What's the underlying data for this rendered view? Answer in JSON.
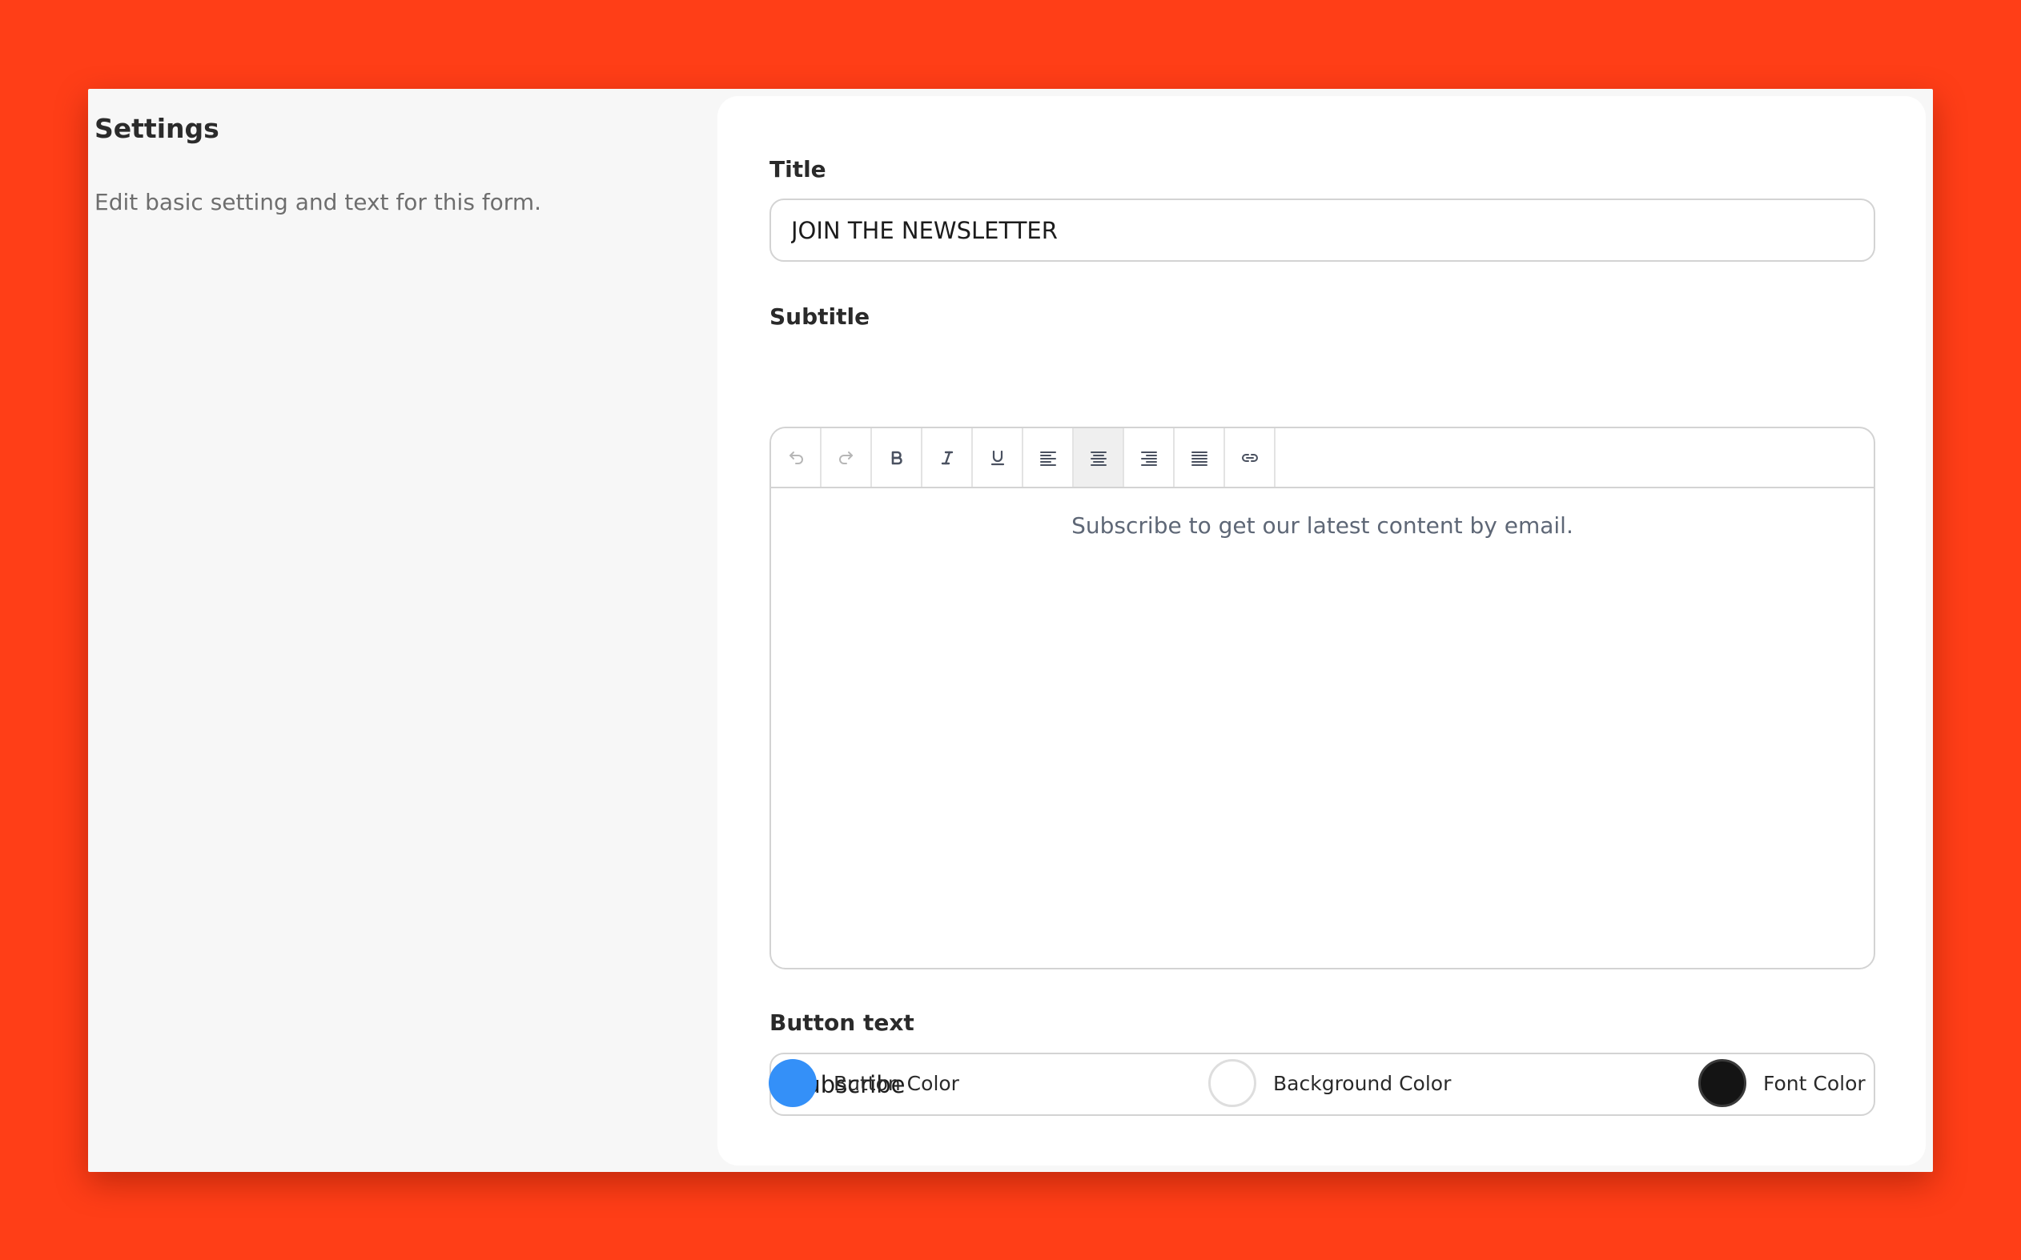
{
  "settings": {
    "heading": "Settings",
    "description": "Edit basic setting and text for this form."
  },
  "form": {
    "title_label": "Title",
    "title_value": "JOIN THE NEWSLETTER",
    "subtitle_label": "Subtitle",
    "subtitle_text": "Subscribe to get our latest content by email.",
    "button_text_label": "Button text",
    "button_text_value": "Subscribe"
  },
  "toolbar": {
    "buttons": [
      "undo-icon",
      "redo-icon",
      "bold-icon",
      "italic-icon",
      "underline-icon",
      "align-left-icon",
      "align-center-icon",
      "align-right-icon",
      "align-justify-icon",
      "link-icon"
    ],
    "active": "align-center-icon"
  },
  "colors": {
    "button_color_label": "Button Color",
    "button_color": "#3490f8",
    "background_color_label": "Background Color",
    "background_color": "#ffffff",
    "font_color_label": "Font Color",
    "font_color": "#141414",
    "page_background": "#ff3e17"
  }
}
